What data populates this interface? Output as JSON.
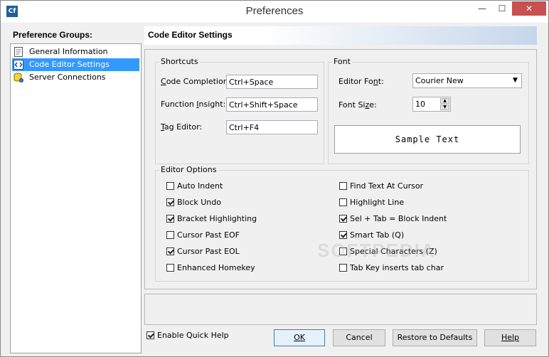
{
  "window": {
    "app_icon": "Cf",
    "title": "Preferences",
    "minimize": "—",
    "maximize": "☐",
    "close": "✕"
  },
  "groups": {
    "label": "Preference Groups:",
    "items": [
      {
        "label": "General Information",
        "icon": "info-page-icon",
        "selected": false
      },
      {
        "label": "Code Editor Settings",
        "icon": "code-tag-icon",
        "selected": true
      },
      {
        "label": "Server Connections",
        "icon": "database-icon",
        "selected": false
      }
    ]
  },
  "header": {
    "title": "Code Editor Settings"
  },
  "shortcuts": {
    "title": "Shortcuts",
    "code_completion": {
      "label_pre": "",
      "label_key": "C",
      "label_post": "ode Completion:",
      "value": "Ctrl+Space"
    },
    "function_insight": {
      "label_pre": "Function ",
      "label_key": "I",
      "label_post": "nsight:",
      "value": "Ctrl+Shift+Space"
    },
    "tag_editor": {
      "label_pre": "",
      "label_key": "T",
      "label_post": "ag Editor:",
      "value": "Ctrl+F4"
    }
  },
  "font": {
    "title": "Font",
    "editor_font_label_pre": "Editor Fo",
    "editor_font_label_key": "n",
    "editor_font_label_post": "t:",
    "editor_font_value": "Courier New",
    "font_size_label_pre": "Font Si",
    "font_size_label_key": "z",
    "font_size_label_post": "e:",
    "font_size_value": "10",
    "sample_text": "Sample Text"
  },
  "editor_options": {
    "title": "Editor Options",
    "left": [
      {
        "label": "Auto Indent",
        "checked": false
      },
      {
        "label": "Block Undo",
        "checked": true
      },
      {
        "label": "Bracket Highlighting",
        "checked": true
      },
      {
        "label": "Cursor Past EOF",
        "checked": false
      },
      {
        "label": "Cursor Past EOL",
        "checked": true
      },
      {
        "label": "Enhanced Homekey",
        "checked": false
      }
    ],
    "right": [
      {
        "label": "Find Text At Cursor",
        "checked": false
      },
      {
        "label": "Highlight Line",
        "checked": false
      },
      {
        "label": "Sel + Tab = Block Indent",
        "checked": true
      },
      {
        "label": "Smart Tab (Q)",
        "checked": true
      },
      {
        "label": "Special Characters (Z)",
        "checked": false
      },
      {
        "label": "Tab Key inserts tab char",
        "checked": false
      }
    ]
  },
  "footer": {
    "quick_help_label": "Enable Quick Help",
    "quick_help_checked": true,
    "ok": "OK",
    "cancel": "Cancel",
    "restore": "Restore to Defaults",
    "help": "Help"
  },
  "watermark": "SOFTPEDIA"
}
